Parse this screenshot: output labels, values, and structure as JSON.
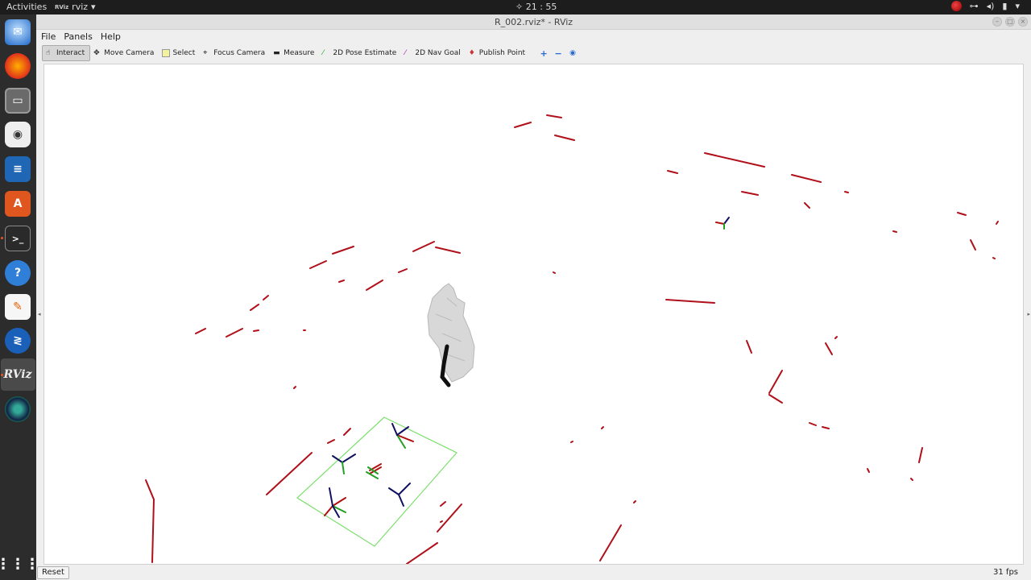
{
  "topbar": {
    "activities": "Activities",
    "app_name": "rviz",
    "app_mini_logo": "RViz",
    "clock": "✧ 21 : 55"
  },
  "dock": {
    "items": [
      "thunderbird-icon",
      "firefox-icon",
      "files-icon",
      "rhythmbox-icon",
      "writer-icon",
      "software-center-icon",
      "terminal-icon",
      "help-icon",
      "text-editor-icon",
      "blue-app-icon",
      "rviz-icon",
      "camera-app-icon"
    ],
    "rviz_label": "RViz"
  },
  "window": {
    "title": "R_002.rviz* - RViz"
  },
  "menu": {
    "file": "File",
    "panels": "Panels",
    "help": "Help"
  },
  "toolbar": {
    "interact": "Interact",
    "move_camera": "Move Camera",
    "select": "Select",
    "focus_camera": "Focus Camera",
    "measure": "Measure",
    "pose_estimate": "2D Pose Estimate",
    "nav_goal": "2D Nav Goal",
    "publish_point": "Publish Point",
    "add": "+",
    "remove": "−",
    "settings": "◉"
  },
  "status": {
    "reset": "Reset",
    "fps": "31 fps"
  },
  "colors": {
    "laser": "#b0101a",
    "grid_box": "#7be06b",
    "axis_x": "#b01010",
    "axis_y": "#20a020",
    "axis_z": "#101060"
  }
}
